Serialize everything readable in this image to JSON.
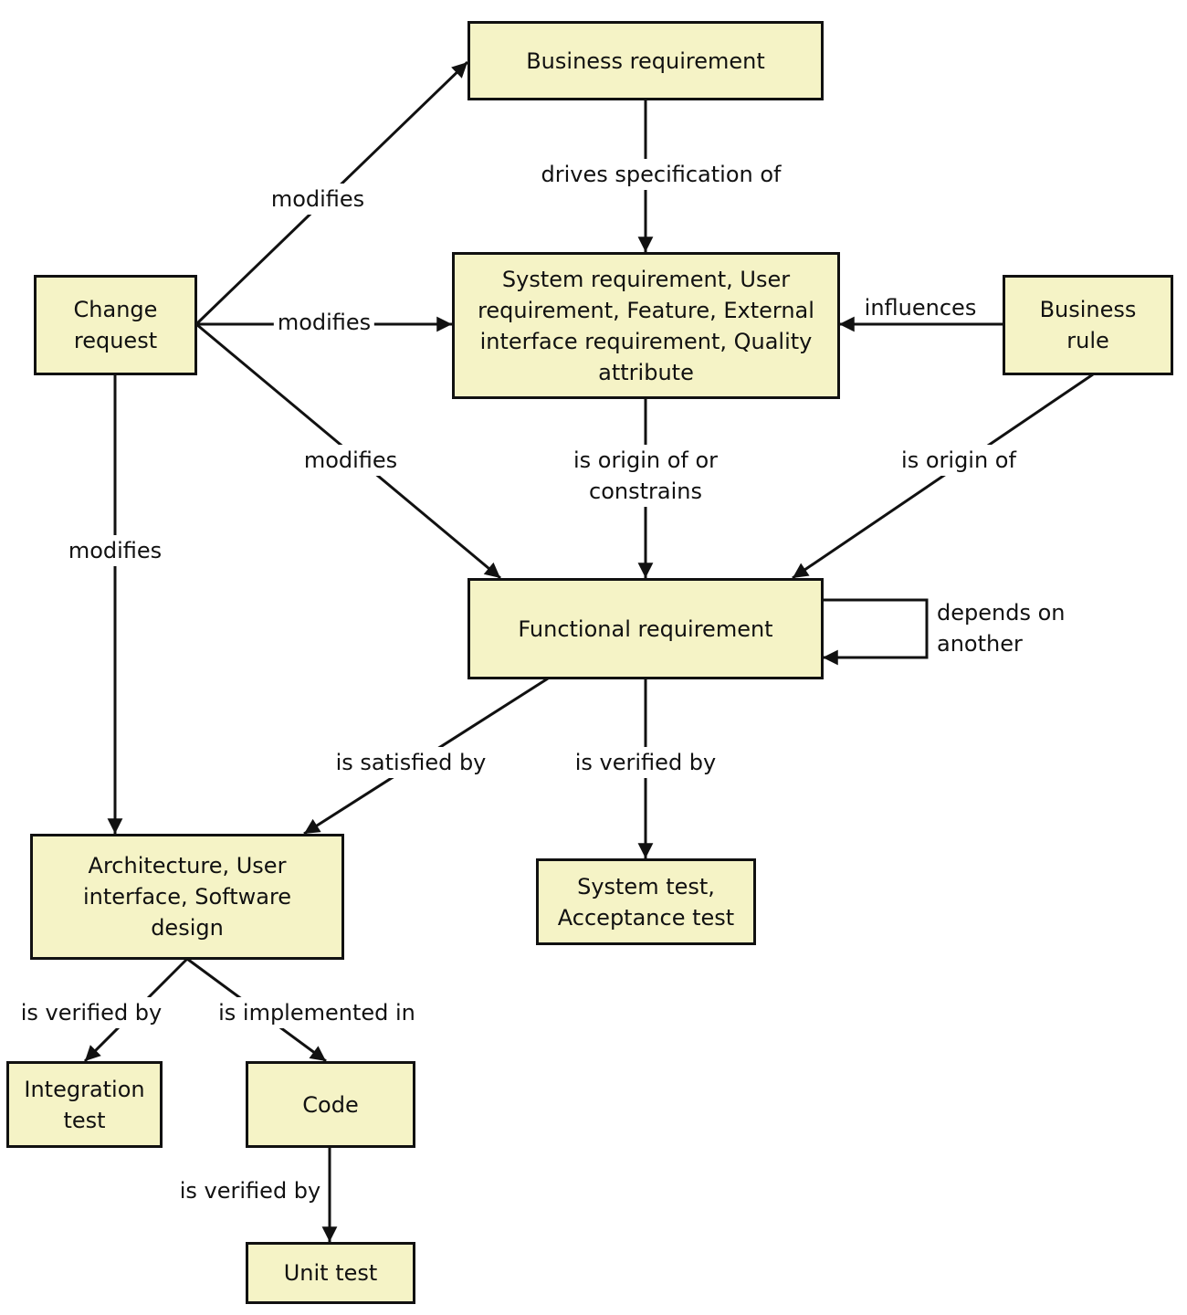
{
  "diagram": {
    "type": "requirements traceability relationships",
    "colors": {
      "node_fill": "#f5f3c6",
      "stroke": "#111111",
      "background": "#ffffff"
    },
    "nodes": {
      "business_requirement": "Business requirement",
      "system_requirement": "System requirement, User requirement, Feature, External interface requirement, Quality attribute",
      "change_request": "Change request",
      "business_rule": "Business rule",
      "functional_requirement": "Functional requirement",
      "design": "Architecture, User interface, Software design",
      "system_test": "System test, Acceptance test",
      "integration_test": "Integration test",
      "code": "Code",
      "unit_test": "Unit test"
    },
    "edges": [
      {
        "from": "change_request",
        "to": "business_requirement",
        "label": "modifies"
      },
      {
        "from": "change_request",
        "to": "system_requirement",
        "label": "modifies"
      },
      {
        "from": "change_request",
        "to": "functional_requirement",
        "label": "modifies"
      },
      {
        "from": "change_request",
        "to": "design",
        "label": "modifies"
      },
      {
        "from": "business_requirement",
        "to": "system_requirement",
        "label": "drives specification of"
      },
      {
        "from": "business_rule",
        "to": "system_requirement",
        "label": "influences"
      },
      {
        "from": "system_requirement",
        "to": "functional_requirement",
        "label": "is origin of or constrains"
      },
      {
        "from": "business_rule",
        "to": "functional_requirement",
        "label": "is origin of"
      },
      {
        "from": "functional_requirement",
        "to": "functional_requirement",
        "label": "depends on another"
      },
      {
        "from": "functional_requirement",
        "to": "design",
        "label": "is satisfied by"
      },
      {
        "from": "functional_requirement",
        "to": "system_test",
        "label": "is verified by"
      },
      {
        "from": "design",
        "to": "integration_test",
        "label": "is verified by"
      },
      {
        "from": "design",
        "to": "code",
        "label": "is implemented in"
      },
      {
        "from": "code",
        "to": "unit_test",
        "label": "is verified by"
      }
    ]
  }
}
